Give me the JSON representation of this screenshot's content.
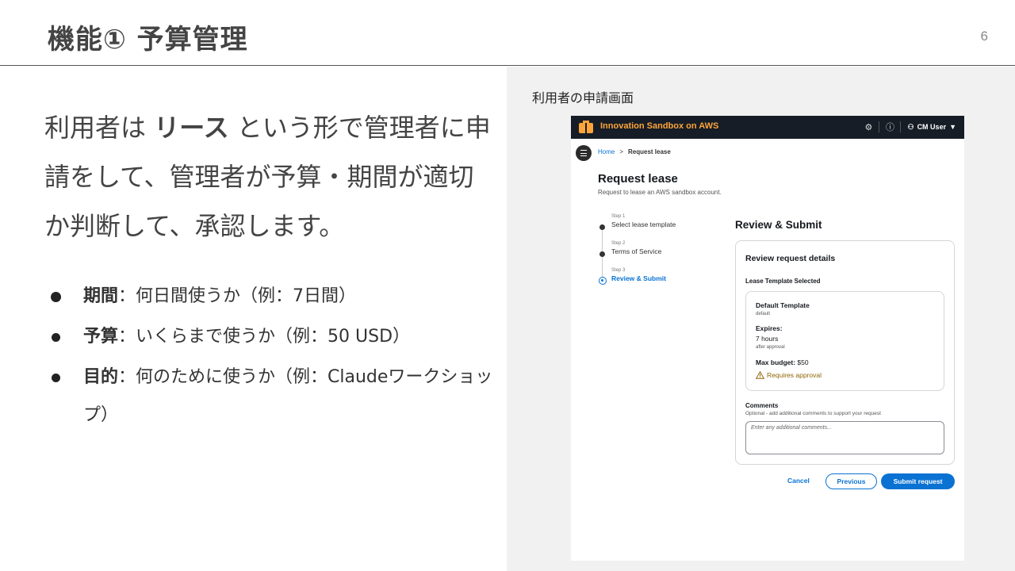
{
  "slide": {
    "title": "機能① 予算管理",
    "page_number": "6"
  },
  "left": {
    "lead_part1": "利用者は ",
    "lead_bold": "リース",
    "lead_part2": " という形で管理者に申請をして、管理者が予算・期間が適切か判断して、承認します。",
    "bullets": [
      {
        "term": "期間",
        "text": "：何日間使うか（例：7日間）"
      },
      {
        "term": "予算",
        "text": "：いくらまで使うか（例：50 USD）"
      },
      {
        "term": "目的",
        "text": "：何のために使うか（例：Claudeワークショップ）"
      }
    ]
  },
  "panel": {
    "caption": "利用者の申請画面"
  },
  "app": {
    "title": "Innovation Sandbox on AWS",
    "icons": [
      "gear-icon",
      "info-icon",
      "user-icon"
    ],
    "user_label": "CM User",
    "breadcrumb": {
      "home": "Home",
      "separator": ">",
      "current": "Request lease"
    },
    "page_title": "Request lease",
    "page_subtitle": "Request to lease an AWS sandbox account.",
    "steps": [
      {
        "number": "Step 1",
        "name": "Select lease template"
      },
      {
        "number": "Step 2",
        "name": "Terms of Service"
      },
      {
        "number": "Step 3",
        "name": "Review & Submit"
      }
    ],
    "review": {
      "title": "Review & Submit",
      "card_heading": "Review request details",
      "template_label": "Lease Template Selected",
      "template_name": "Default Template",
      "template_id": "default",
      "expires_label": "Expires:",
      "expires_value": "7 hours",
      "expires_note": "after approval",
      "max_budget_label": "Max budget:",
      "max_budget_value": " $50",
      "approval": "Requires approval",
      "comments_label": "Comments",
      "comments_hint": "Optional - add additional comments to support your request",
      "comments_placeholder": "Enter any additional comments...",
      "comments_value": ""
    },
    "buttons": {
      "cancel": "Cancel",
      "previous": "Previous",
      "submit": "Submit request"
    },
    "colors": {
      "topbar": "#161d26",
      "brand_orange": "#ffa43a",
      "primary_blue": "#0972d3",
      "warning": "#8d6605"
    }
  }
}
